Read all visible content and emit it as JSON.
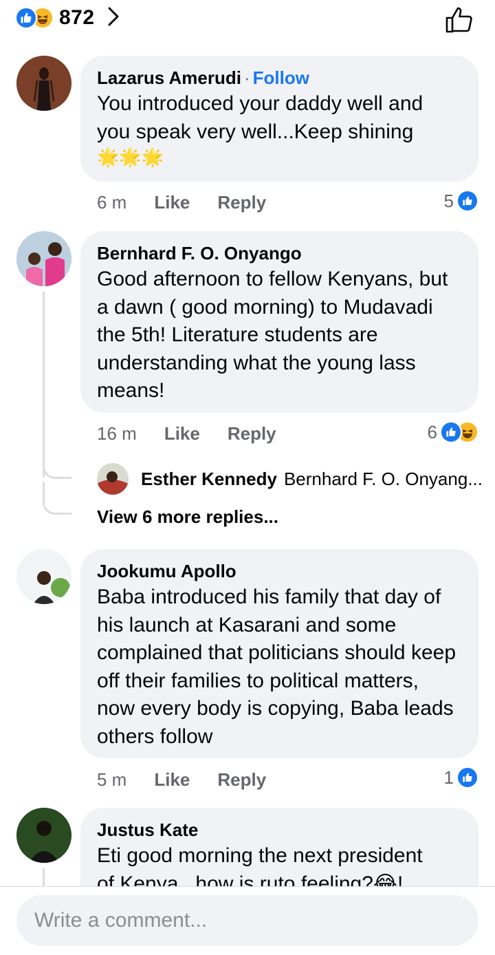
{
  "reactions": {
    "total": "872",
    "types": [
      "like",
      "haha"
    ]
  },
  "comments": [
    {
      "author": "Lazarus Amerudi",
      "follow_label": "Follow",
      "text_line1": "You introduced your daddy well and",
      "text_line2": "you speak very well...Keep shining",
      "emoji": "🌟🌟🌟",
      "time": "6 m",
      "like_label": "Like",
      "reply_label": "Reply",
      "reaction_count": "5",
      "reaction_types": [
        "like"
      ]
    },
    {
      "author": "Bernhard F. O. Onyango",
      "text": "Good afternoon to fellow Kenyans, but a dawn ( good morning) to Mudavadi the 5th! Literature students are understanding what the young lass means!",
      "time": "16 m",
      "like_label": "Like",
      "reply_label": "Reply",
      "reaction_count": "6",
      "reaction_types": [
        "like",
        "haha"
      ],
      "reply_preview": {
        "author": "Esther Kennedy",
        "text": "Bernhard F. O. Onyang..."
      },
      "view_more": "View 6 more replies..."
    },
    {
      "author": "Jookumu Apollo",
      "text": "Baba introduced his family that day of his launch at Kasarani and some complained that politicians should keep off their families to political matters, now every body is copying, Baba leads others follow",
      "time": "5 m",
      "like_label": "Like",
      "reply_label": "Reply",
      "reaction_count": "1",
      "reaction_types": [
        "like"
      ]
    },
    {
      "author": "Justus Kate",
      "text_line1": "Eti good morning the next president",
      "text_line2": "of Kenya...how is ruto feeling?😂!"
    }
  ],
  "composer": {
    "placeholder": "Write a comment..."
  },
  "colors": {
    "accent": "#1877f2",
    "bubble": "#f0f2f5",
    "meta": "#65676b",
    "haha": "#f7b928"
  }
}
